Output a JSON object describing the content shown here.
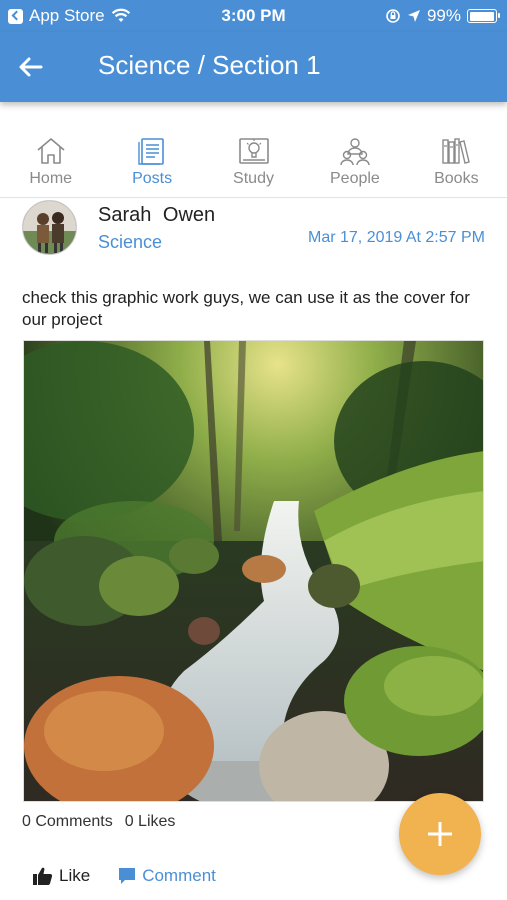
{
  "status_bar": {
    "carrier": "App Store",
    "time": "3:00 PM",
    "battery": "99%",
    "battery_level": 0.99,
    "icons": [
      "back-to-app-icon",
      "wifi-icon",
      "orientation-lock-icon",
      "location-icon",
      "battery-icon"
    ]
  },
  "app_bar": {
    "title": "Science / Section 1",
    "back_icon": "arrow-left-icon"
  },
  "tabs": [
    {
      "label": "Home",
      "icon": "home-icon",
      "active": false
    },
    {
      "label": "Posts",
      "icon": "posts-icon",
      "active": true
    },
    {
      "label": "Study",
      "icon": "study-icon",
      "active": false
    },
    {
      "label": "People",
      "icon": "people-icon",
      "active": false
    },
    {
      "label": "Books",
      "icon": "books-icon",
      "active": false
    }
  ],
  "post": {
    "author": "Sarah Owen",
    "subject": "Science",
    "timestamp": "Mar 17, 2019 At 2:57 PM",
    "text": "check this graphic work guys, we can use it as the cover for our project",
    "comments": "0 Comments",
    "likes": "0 Likes",
    "like_label": "Like",
    "comment_label": "Comment"
  },
  "colors": {
    "primary": "#4a8fd6",
    "fab": "#f1b250",
    "inactive": "#8a8a8a"
  }
}
